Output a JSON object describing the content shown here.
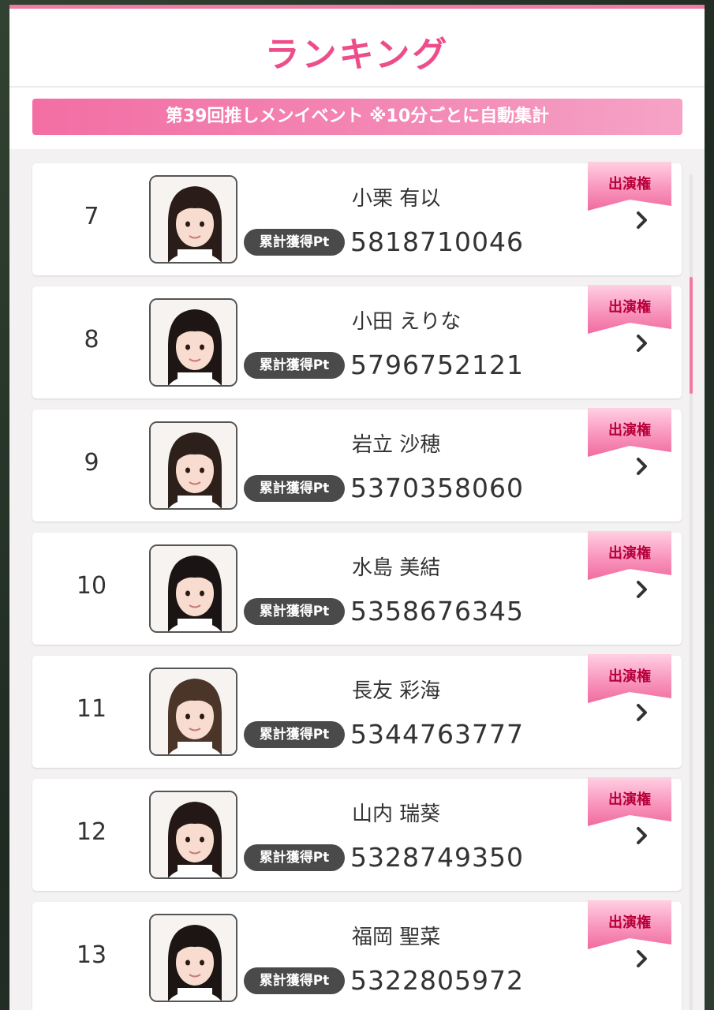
{
  "header": {
    "title": "ランキング"
  },
  "banner": {
    "text": "第39回推しメンイベント ※10分ごとに自動集計"
  },
  "pt_label": "累計獲得Pt",
  "ribbon_label": "出演権",
  "colors": {
    "accent": "#ee4d8b",
    "banner": "#f36ea4",
    "badge": "#4a4a4a"
  },
  "items": [
    {
      "rank": "7",
      "name": "小栗 有以",
      "points": "5818710046"
    },
    {
      "rank": "8",
      "name": "小田 えりな",
      "points": "5796752121"
    },
    {
      "rank": "9",
      "name": "岩立 沙穂",
      "points": "5370358060"
    },
    {
      "rank": "10",
      "name": "水島 美結",
      "points": "5358676345"
    },
    {
      "rank": "11",
      "name": "長友 彩海",
      "points": "5344763777"
    },
    {
      "rank": "12",
      "name": "山内 瑞葵",
      "points": "5328749350"
    },
    {
      "rank": "13",
      "name": "福岡 聖菜",
      "points": "5322805972"
    }
  ]
}
